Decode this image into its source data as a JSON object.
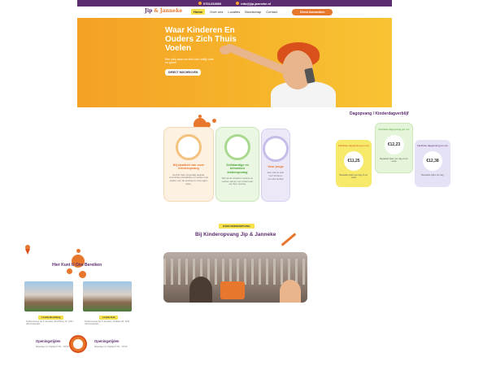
{
  "topbar": {
    "phone": "0701234560",
    "email": "info@jip-janneke.nl"
  },
  "logo": {
    "part1": "Jip",
    "part2": "& Janneke"
  },
  "nav": {
    "items": [
      "Home",
      "Over ons",
      "Locaties",
      "Boodschap",
      "Contact"
    ],
    "cta": "Direct Aanmelden"
  },
  "hero": {
    "title": "Waar Kinderen En Ouders Zich Thuis Voelen",
    "subtitle": "Een plek waar uw kind zich veilig voelt en groeit",
    "button": "DIRECT INSCHRIJVEN"
  },
  "cards": [
    {
      "title": "Bij kwaliteit van onze Kinderopvang",
      "text": "Gericht naar zorgvuldig aanpak, voorzichtig ontwikkelen en werken met passie voor de opvang en onze eigen wijze."
    },
    {
      "title": "Zelfstandige en betrokken kinderopvang",
      "text": "Wij nemen kinderen serieus en werken samen met ouders aan een fijne opvang."
    },
    {
      "title": "Voor jonge",
      "text": "Een warme plek voor kinderen van elke leeftijd."
    }
  ],
  "prices": {
    "title": "Dagopvang / Kinderdagverblijf",
    "items": [
      {
        "label": "Flexibele dagopvang per uur",
        "price": "€11,25",
        "note": "Bepaalde tijden per dag of per week"
      },
      {
        "label": "Flexibele dagopvang per uur",
        "price": "€12,23",
        "note": "Bepaalde tijden per dag of per week"
      },
      {
        "label": "Flexibele dagopvang per uur",
        "price": "€12,38",
        "note": "Bepaalde tijden per dag"
      }
    ]
  },
  "video_section": {
    "tag": "OVER KINDEROPVANG",
    "title": "Bij Kinderopvang Jip & Janneke"
  },
  "locations": {
    "title": "Hier Kunt U Ons Bereiken",
    "items": [
      {
        "tag": "Locatie Boschberg",
        "address": "Kinderopvang Jip & Janneke, Boschberg 12, 1234 AB Amsterdam",
        "open_title": "Openingstijden",
        "hours": "Maandag t/m Vrijdag 07:00 – 18:30"
      },
      {
        "tag": "Locatie Zuid",
        "address": "Kinderopvang Jip & Janneke, Zuidlaan 45, 1234 CD Amsterdam",
        "open_title": "Openingstijden",
        "hours": "Maandag t/m Vrijdag 07:00 – 18:30"
      }
    ]
  },
  "colors": {
    "purple": "#5b2c6f",
    "orange": "#e8772e",
    "yellow": "#f7e14a"
  }
}
